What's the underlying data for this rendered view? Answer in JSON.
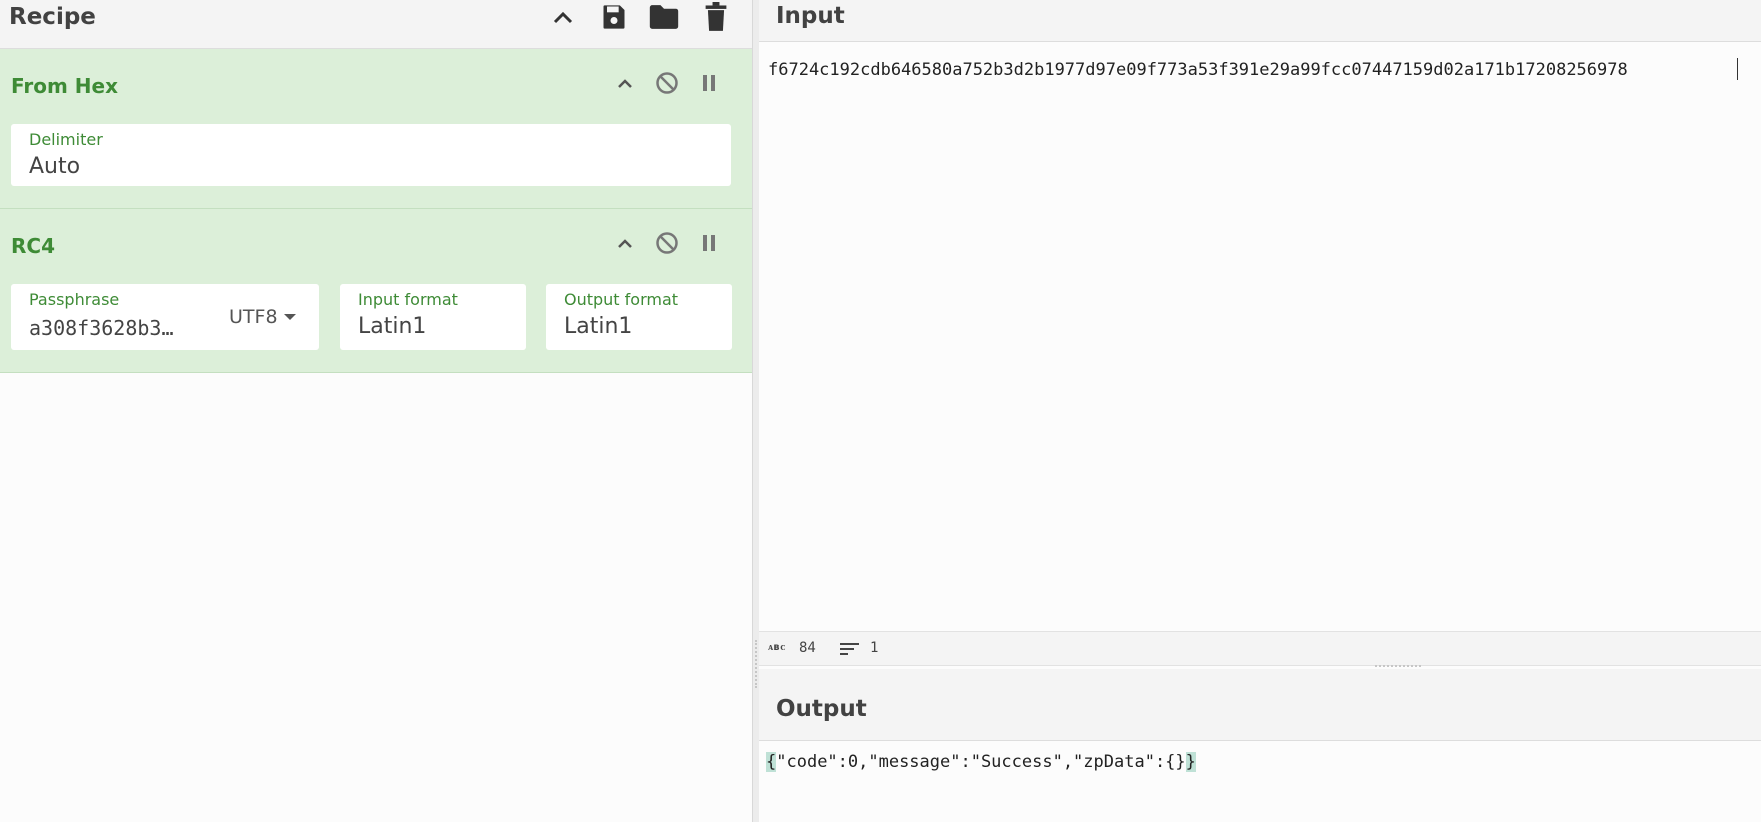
{
  "recipe": {
    "title": "Recipe",
    "operations": [
      {
        "name": "From Hex",
        "fields": [
          {
            "label": "Delimiter",
            "value": "Auto"
          }
        ]
      },
      {
        "name": "RC4",
        "fields": [
          {
            "label": "Passphrase",
            "value": "a308f3628b3…",
            "encoding": "UTF8"
          },
          {
            "label": "Input format",
            "value": "Latin1"
          },
          {
            "label": "Output format",
            "value": "Latin1"
          }
        ]
      }
    ]
  },
  "input": {
    "title": "Input",
    "text": "f6724c192cdb646580a752b3d2b1977d97e09f773a53f391e29a99fcc07447159d02a171b17208256978"
  },
  "status": {
    "length": "84",
    "lines": "1"
  },
  "output": {
    "title": "Output",
    "text_first": "{",
    "text_middle": "\"code\":0,\"message\":\"Success\",\"zpData\":{}",
    "text_last": "}"
  },
  "colors": {
    "op_background": "#dcefd9",
    "op_title": "#3e8b36",
    "highlight": "#bfe1d6"
  }
}
